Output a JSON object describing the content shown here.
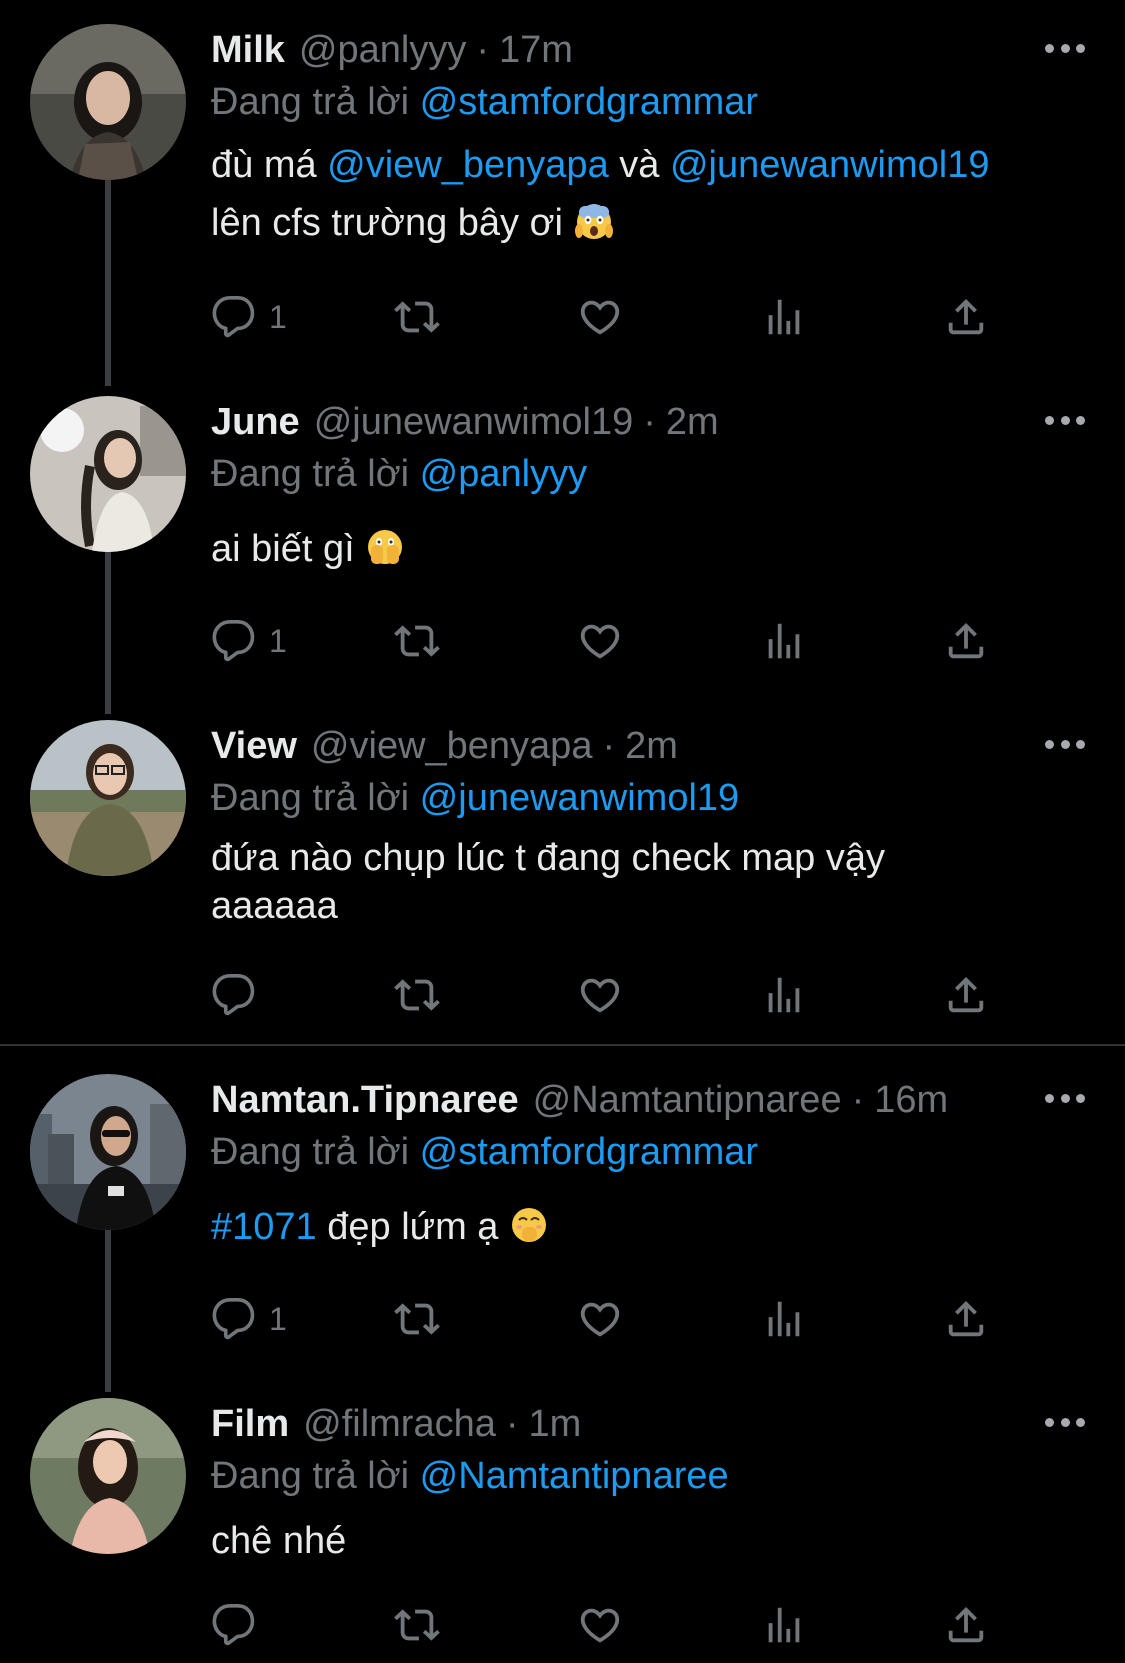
{
  "colors": {
    "background": "#000000",
    "text": "#e7e9ea",
    "muted": "#71767b",
    "link": "#1d9bf0",
    "thread_line": "#3a3d41"
  },
  "reply_prefix": "Đang trả lời",
  "tweets": [
    {
      "name": "Milk",
      "handle": "@panlyyy",
      "time": "17m",
      "reply_to": "@stamfordgrammar",
      "body": {
        "line1_a": "đù má ",
        "mention1": "@view_benyapa",
        "line1_b": " và ",
        "mention2": "@junewanwimol19",
        "line2": "lên cfs trường bây ơi ",
        "emoji": "face-screaming-in-fear-emoji"
      },
      "reply_count": "1"
    },
    {
      "name": "June",
      "handle": "@junewanwimol19",
      "time": "2m",
      "reply_to": "@panlyyy",
      "body": {
        "text": "ai biết gì ",
        "emoji": "face-with-open-eyes-and-hand-over-mouth-emoji"
      },
      "reply_count": "1"
    },
    {
      "name": "View",
      "handle": "@view_benyapa",
      "time": "2m",
      "reply_to": "@junewanwimol19",
      "body": {
        "line1": "đứa nào chụp lúc t đang check map vậy",
        "line2": "aaaaaa"
      },
      "reply_count": ""
    },
    {
      "name": "Namtan.Tipnaree",
      "handle": "@Namtantipnaree",
      "time": "16m",
      "reply_to": "@stamfordgrammar",
      "body": {
        "hashtag": "#1071",
        "text": " đẹp lứm ạ ",
        "emoji": "face-with-hand-over-mouth-emoji"
      },
      "reply_count": "1"
    },
    {
      "name": "Film",
      "handle": "@filmracha",
      "time": "1m",
      "reply_to": "@Namtantipnaree",
      "body": {
        "text": "chê nhé"
      },
      "reply_count": ""
    }
  ],
  "icons": {
    "reply": "reply-icon",
    "retweet": "retweet-icon",
    "like": "heart-icon",
    "views": "views-icon",
    "share": "share-icon",
    "more": "more-icon"
  },
  "separator": "·"
}
